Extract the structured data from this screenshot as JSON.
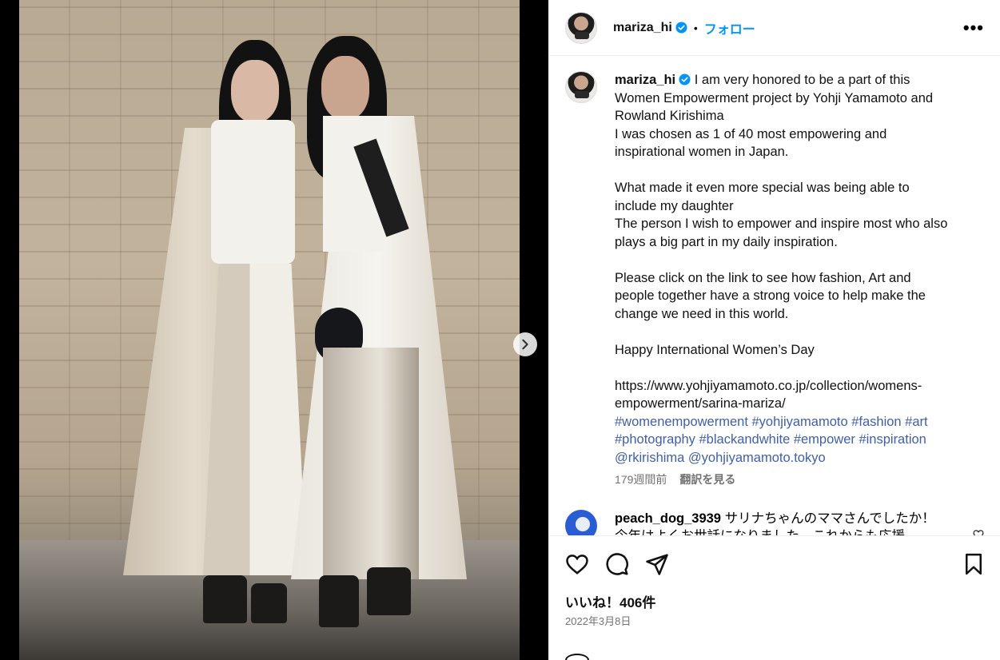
{
  "header": {
    "username": "mariza_hi",
    "separator": "•",
    "follow_label": "フォロー",
    "more_label": "•••"
  },
  "post": {
    "username": "mariza_hi",
    "caption_lines": [
      "I am very honored to be a part of this",
      "Women Empowerment project by Yohji Yamamoto and",
      "Rowland Kirishima",
      "I was chosen as 1 of 40 most empowering and",
      "inspirational women in Japan.",
      "",
      "What made it even more special was being able to",
      "include my daughter",
      "The person I wish to empower and inspire most who also",
      "plays a big part in my daily inspiration.",
      "",
      "Please click on the link to see how fashion, Art and",
      "people together have a strong voice to help make the",
      "change we need in this world.",
      "",
      "Happy International Women’s Day",
      "",
      "https://www.yohjiyamamoto.co.jp/collection/womens-",
      "empowerment/sarina-mariza/"
    ],
    "hashtag_lines": [
      "#womenempowerment #yohjiyamamoto #fashion #art",
      "#photography #blackandwhite #empower #inspiration",
      "@rkirishima @yohjiyamamoto.tokyo"
    ],
    "time_ago": "179週間前",
    "translate_label": "翻訳を見る"
  },
  "comment": {
    "username": "peach_dog_3939",
    "text": "サリナちゃんのママさんでしたか！",
    "text_line2": "今年はよくお世話になりました　これからも応援"
  },
  "footer": {
    "likes": "いいね！406件",
    "date": "2022年3月8日"
  },
  "icons": {
    "like": "heart-icon",
    "comment": "comment-bubble-icon",
    "share": "paper-plane-icon",
    "save": "bookmark-icon",
    "next": "chevron-right-icon",
    "verified": "verified-badge-icon"
  },
  "colors": {
    "follow": "#0095f6",
    "hashtag": "#3f5fa8",
    "muted": "#737373",
    "verified": "#0095f6"
  }
}
